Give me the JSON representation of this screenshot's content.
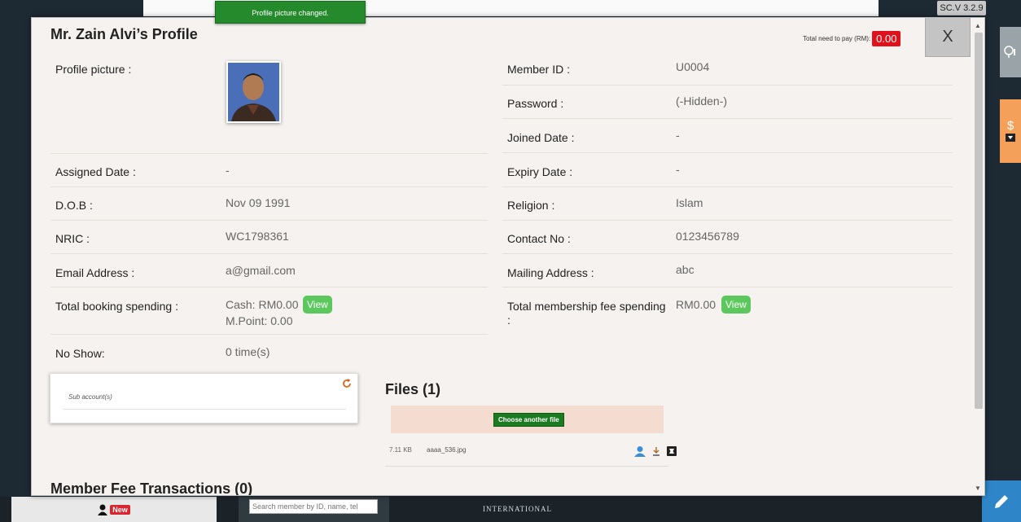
{
  "app": {
    "version": "SC.V 3.2.9",
    "brand": "INTERNATIONAL",
    "new_badge": "New",
    "search_placeholder": "Search member by ID, name, tel"
  },
  "toast": "Profile picture changed.",
  "modal": {
    "title": "Mr. Zain Alvi’s Profile",
    "close_label": "X",
    "total_pay_label": "Total need to pay (RM):",
    "total_pay_amount": "0.00",
    "left": {
      "profile_picture_label": "Profile picture :",
      "assigned_date_label": "Assigned Date :",
      "assigned_date_value": "-",
      "dob_label": "D.O.B :",
      "dob_value": "Nov 09 1991",
      "nric_label": "NRIC :",
      "nric_value": "WC1798361",
      "email_label": "Email Address :",
      "email_value": "a@gmail.com",
      "booking_label": "Total booking spending :",
      "booking_cash": "Cash: RM0.00",
      "booking_mpoint": "M.Point: 0.00",
      "noshow_label": "No Show:",
      "noshow_value": "0 time(s)"
    },
    "right": {
      "member_id_label": "Member ID :",
      "member_id_value": "U0004",
      "password_label": "Password :",
      "password_value": "(-Hidden-)",
      "joined_label": "Joined Date :",
      "joined_value": "-",
      "expiry_label": "Expiry Date :",
      "expiry_value": "-",
      "religion_label": "Religion :",
      "religion_value": "Islam",
      "contact_label": "Contact No :",
      "contact_value": "0123456789",
      "mailing_label": "Mailing Address :",
      "mailing_value": "abc",
      "membership_fee_label_1": "Total membership fee spending",
      "membership_fee_label_2": ":",
      "membership_fee_value": "RM0.00"
    },
    "view_label": "View",
    "sub_accounts_label": "Sub account(s)",
    "files": {
      "title": "Files (1)",
      "choose_label": "Choose another file",
      "items": [
        {
          "size": "7.11 KB",
          "name": "aaaa_536.jpg"
        }
      ]
    },
    "member_fee_title": "Member Fee Transactions (0)"
  },
  "colors": {
    "accent_red": "#e0111b",
    "view_green": "#5cc75c",
    "toast_green": "#248a2c",
    "side_orange": "#f4a05a",
    "fab_blue": "#2e86c9"
  }
}
